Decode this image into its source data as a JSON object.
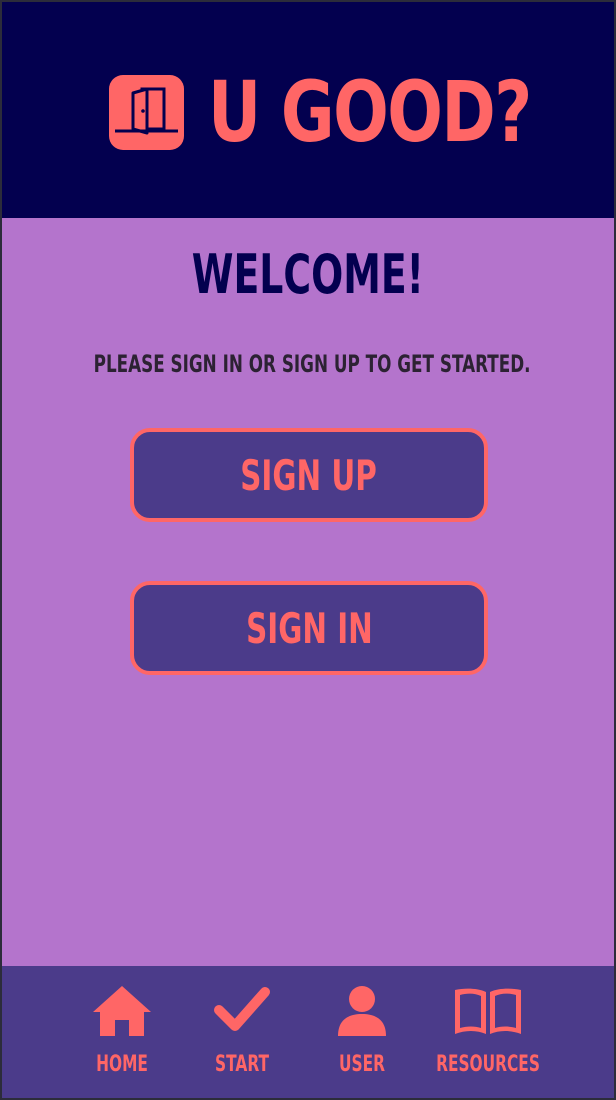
{
  "header": {
    "title": "U GOOD?",
    "logo_icon": "door-open-icon"
  },
  "main": {
    "welcome": "WELCOME!",
    "subtitle": "PLEASE SIGN IN OR SIGN UP TO GET STARTED.",
    "signup_label": "SIGN UP",
    "signin_label": "SIGN IN"
  },
  "nav": {
    "items": [
      {
        "label": "HOME",
        "icon": "home-icon"
      },
      {
        "label": "START",
        "icon": "checkmark-icon"
      },
      {
        "label": "USER",
        "icon": "user-icon"
      },
      {
        "label": "RESOURCES",
        "icon": "book-icon"
      }
    ]
  },
  "colors": {
    "header_bg": "#03004f",
    "accent": "#ff6666",
    "page_bg": "#b474cc",
    "button_bg": "#4b3b8a",
    "nav_bg": "#4b3b8a"
  }
}
